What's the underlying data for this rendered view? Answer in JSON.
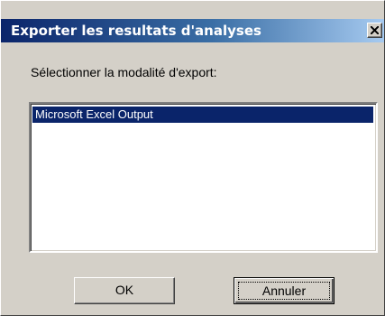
{
  "window": {
    "title": "Exporter les resultats d'analyses",
    "close_glyph": "X"
  },
  "dialog": {
    "prompt": "Sélectionner la modalité d'export:",
    "export_options": [
      {
        "label": "Microsoft Excel Output",
        "selected": true
      }
    ]
  },
  "buttons": {
    "ok_label": "OK",
    "cancel_label": "Annuler"
  },
  "colors": {
    "title_gradient_start": "#0a246a",
    "title_gradient_end": "#a6caf0",
    "selection_background": "#0a246a",
    "dialog_background": "#d4d0c8"
  }
}
